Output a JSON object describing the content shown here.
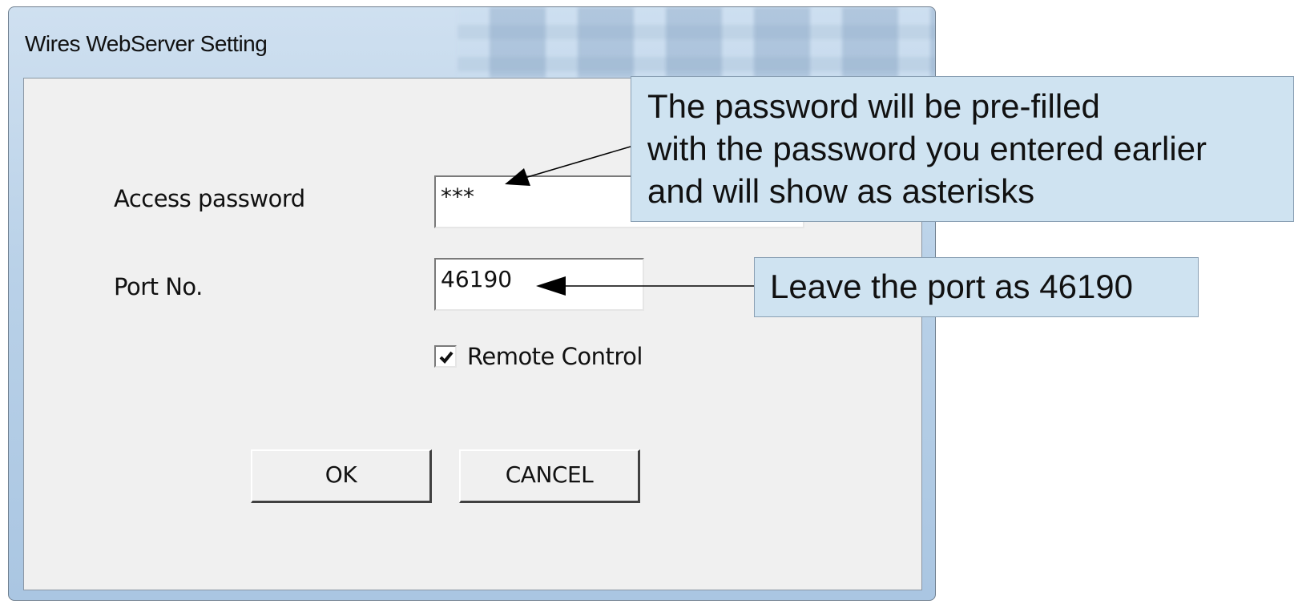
{
  "window": {
    "title": "Wires WebServer Setting"
  },
  "form": {
    "password_label": "Access password",
    "password_value": "***",
    "port_label": "Port No.",
    "port_value": "46190",
    "remote_control_label": "Remote Control",
    "remote_control_checked": true
  },
  "buttons": {
    "ok_label": "OK",
    "cancel_label": "CANCEL"
  },
  "callouts": {
    "password_note": [
      "The password will be pre-filled",
      "with the password you entered earlier",
      "and will show as asterisks"
    ],
    "port_note": "Leave the port as 46190"
  },
  "colors": {
    "callout_background": "#cfe3f1",
    "dialog_background": "#f0f0f0",
    "window_frame": "#b9d1e8"
  }
}
